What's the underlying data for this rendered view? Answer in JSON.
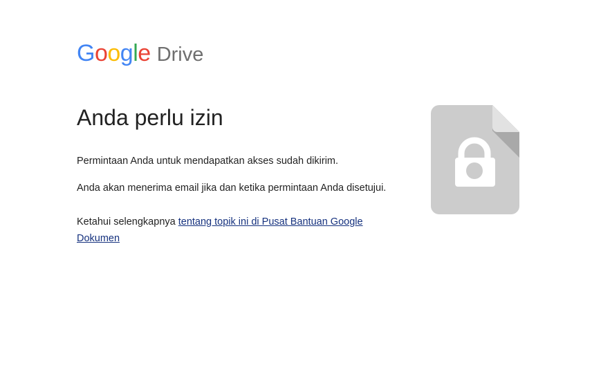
{
  "logo": {
    "letters": [
      {
        "char": "G",
        "color": "#4285F4"
      },
      {
        "char": "o",
        "color": "#EA4335"
      },
      {
        "char": "o",
        "color": "#FBBC05"
      },
      {
        "char": "g",
        "color": "#4285F4"
      },
      {
        "char": "l",
        "color": "#34A853"
      },
      {
        "char": "e",
        "color": "#EA4335"
      }
    ],
    "product": "Drive"
  },
  "page": {
    "title": "Anda perlu izin",
    "message1": "Permintaan Anda untuk mendapatkan akses sudah dikirim.",
    "message2": "Anda akan menerima email jika dan ketika permintaan Anda disetujui.",
    "learn_more_prefix": "Ketahui selengkapnya ",
    "learn_more_link": "tentang topik ini di Pusat Bantuan Google Dokumen"
  },
  "icon": {
    "name": "locked-document-icon",
    "body_color": "#cccccc",
    "fold_color": "#a9a9a9",
    "lock_color": "#ffffff"
  }
}
